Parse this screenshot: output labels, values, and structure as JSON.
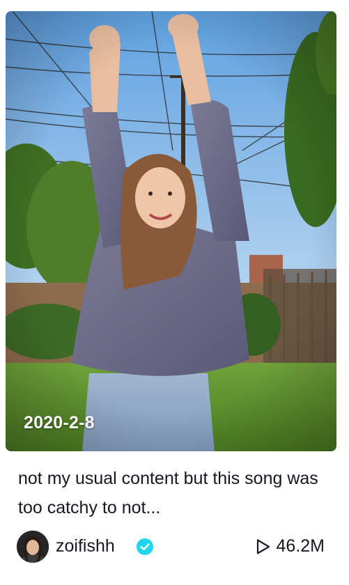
{
  "video": {
    "date_overlay": "2020-2-8",
    "caption": "not my usual content but this song was too catchy to not...",
    "author": {
      "username": "zoifishh",
      "verified": true,
      "verified_icon": "verified-check-icon"
    },
    "views": "46.2M",
    "views_icon": "play-outline-icon"
  },
  "colors": {
    "text": "#161823",
    "verified_badge": "#20d5ec",
    "overlay_text": "#ffffff"
  }
}
